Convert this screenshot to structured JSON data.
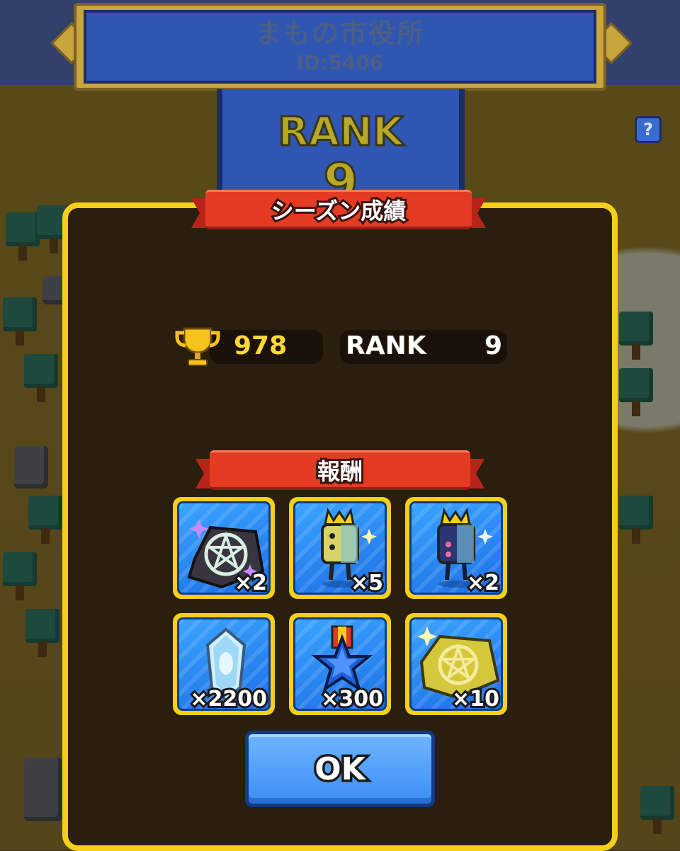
{
  "header": {
    "title": "まもの市役所",
    "id_text": "ID:5406",
    "rank_label": "RANK",
    "rank_number": "9",
    "help_label": "?"
  },
  "dialog": {
    "title": "シーズン成績",
    "score": "978",
    "rank_label": "RANK",
    "rank_value": "9",
    "rewards_title": "報酬",
    "rewards": [
      {
        "icon": "dark-pentagram-map-icon",
        "qty": "×2"
      },
      {
        "icon": "gold-crowned-dice-icon",
        "qty": "×5"
      },
      {
        "icon": "blue-crowned-dice-icon",
        "qty": "×2"
      },
      {
        "icon": "crystal-gem-icon",
        "qty": "×2200"
      },
      {
        "icon": "blue-star-medal-icon",
        "qty": "×300"
      },
      {
        "icon": "gold-pentagram-map-icon",
        "qty": "×10"
      }
    ],
    "ok_label": "OK"
  },
  "colors": {
    "dialog_border": "#f5cf1a",
    "ribbon": "#e53b22",
    "tile_blue": "#1c6fe6",
    "ok_button": "#3d8ef5",
    "score_text": "#ffd83a"
  }
}
